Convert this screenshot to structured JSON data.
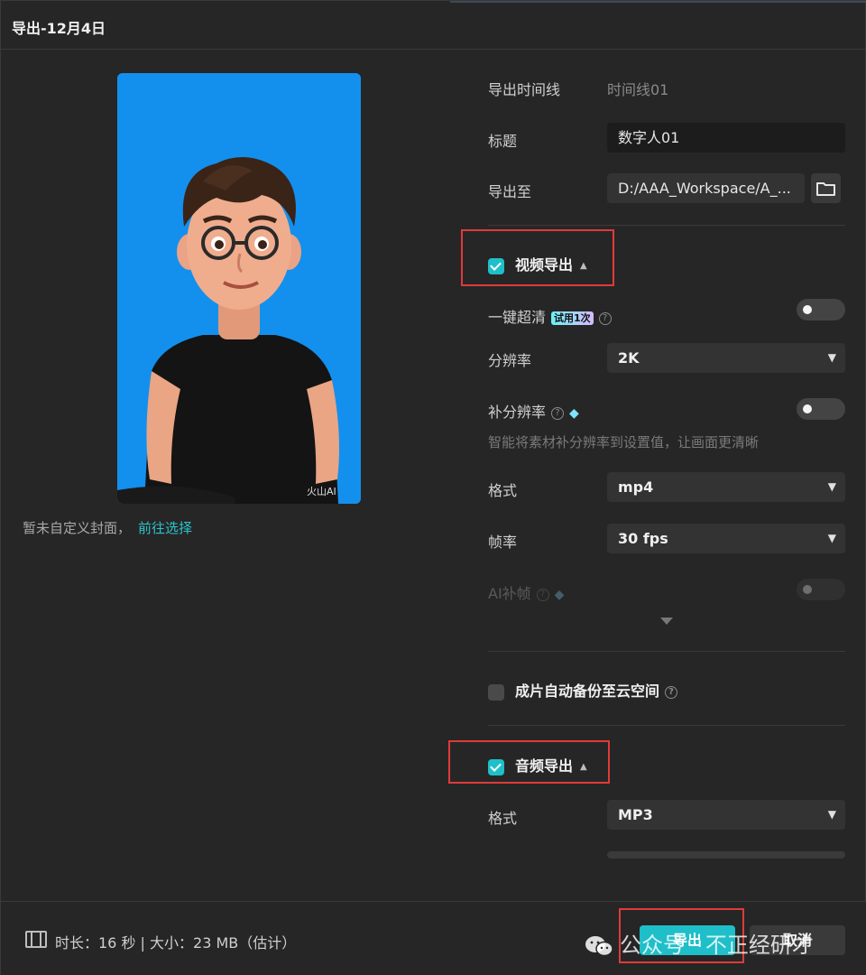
{
  "window": {
    "title": "导出-12月4日"
  },
  "preview": {
    "image_description": "卡通男孩头像，蓝色背景",
    "watermark_text": "火山AI",
    "cover_note": "暂未自定义封面，",
    "cover_link": "前往选择"
  },
  "form": {
    "timeline_label": "导出时间线",
    "timeline_value": "时间线01",
    "title_label": "标题",
    "title_value": "数字人01",
    "export_to_label": "导出至",
    "export_to_value": "D:/AAA_Workspace/A_..."
  },
  "video_export": {
    "header": "视频导出",
    "checked": true,
    "one_click_hd_label": "一键超清",
    "trial_badge": "试用1次",
    "one_click_hd_on": false,
    "resolution_label": "分辨率",
    "resolution_value": "2K",
    "supplement_label": "补分辨率",
    "supplement_on": false,
    "supplement_hint": "智能将素材补分辨率到设置值，让画面更清晰",
    "format_label": "格式",
    "format_value": "mp4",
    "framerate_label": "帧率",
    "framerate_value": "30 fps",
    "ai_frame_label": "AI补帧",
    "ai_frame_on": false
  },
  "cloud_backup": {
    "label": "成片自动备份至云空间",
    "checked": false
  },
  "audio_export": {
    "header": "音频导出",
    "checked": true,
    "format_label": "格式",
    "format_value": "MP3"
  },
  "footer": {
    "info": "时长：16 秒 | 大小：23 MB（估计）",
    "export_button": "导出",
    "cancel_button": "取消",
    "watermark": "公众号 · 不正经研才"
  },
  "colors": {
    "accent": "#1fbfc9",
    "highlight_box": "#e03a3a",
    "background": "#262626"
  }
}
